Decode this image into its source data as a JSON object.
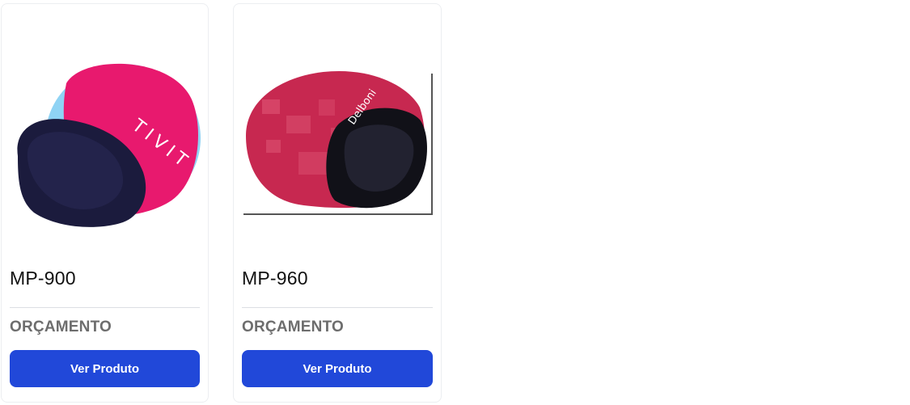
{
  "products": [
    {
      "name": "MP-900",
      "price_label": "ORÇAMENTO",
      "button_label": "Ver Produto",
      "image_logo_text": "TIVIT",
      "colors": {
        "pad_main": "#e8196e",
        "pad_rest": "#1b1b3d",
        "pad_accent": "#8fd3f4"
      }
    },
    {
      "name": "MP-960",
      "price_label": "ORÇAMENTO",
      "button_label": "Ver Produto",
      "image_logo_text": "Delboni",
      "colors": {
        "pad_main": "#c72850",
        "pad_rest": "#111118",
        "pad_accent": "#e15a78"
      }
    }
  ],
  "theme": {
    "button_color": "#2148d9",
    "price_color": "#6d6d6d",
    "title_color": "#111111"
  }
}
